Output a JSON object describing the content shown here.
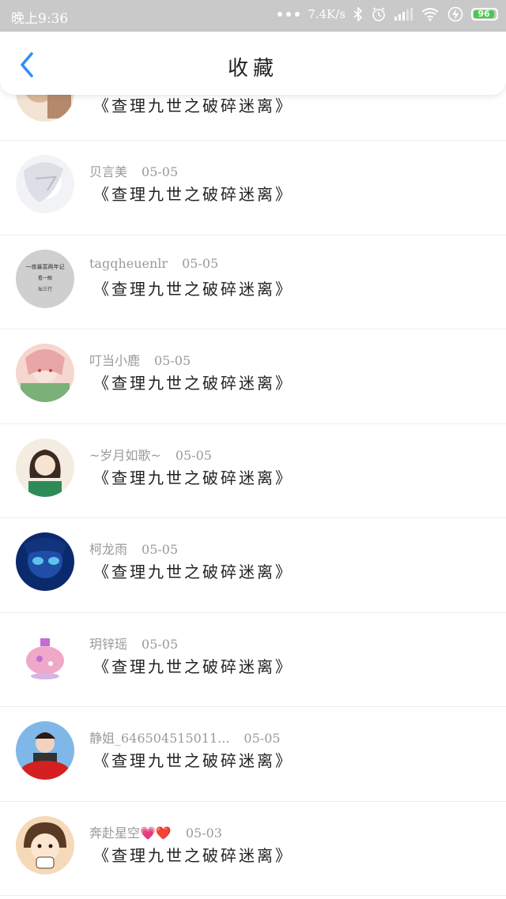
{
  "status_bar": {
    "time": "晚上9:36",
    "network_speed": "7.4K/s",
    "battery": "96",
    "colors": {
      "battery_fill": "#49c84b"
    }
  },
  "header": {
    "title": "收藏",
    "back_icon": "chevron-left-icon",
    "accent": "#2f8ff0"
  },
  "favorites": [
    {
      "user": "",
      "date": "",
      "post": "《查理九世之破碎迷离》",
      "avatar_colors": [
        "#d9b89a",
        "#f3e3d3",
        "#b48a6a"
      ]
    },
    {
      "user": "贝言美",
      "date": "05-05",
      "post": "《查理九世之破碎迷离》",
      "avatar_colors": [
        "#e7e9ee",
        "#ffffff",
        "#b9bcc6"
      ]
    },
    {
      "user": "tagqheuenlr",
      "date": "05-05",
      "post": "《查理九世之破碎迷离》",
      "avatar_text": [
        "一夜暴富两年记",
        "看一眼",
        "坛三行"
      ],
      "avatar_colors": [
        "#cfcfcf",
        "#cfcfcf",
        "#333333"
      ]
    },
    {
      "user": "叮当小鹿",
      "date": "05-05",
      "post": "《查理九世之破碎迷离》",
      "avatar_colors": [
        "#e9a6a6",
        "#f5d7d0",
        "#7bb079"
      ]
    },
    {
      "user": "~岁月如歌~",
      "date": "05-05",
      "post": "《查理九世之破碎迷离》",
      "avatar_colors": [
        "#f4ece0",
        "#3b2a22",
        "#2e8b57"
      ]
    },
    {
      "user": "柯龙雨",
      "date": "05-05",
      "post": "《查理九世之破碎迷离》",
      "avatar_colors": [
        "#1f4da8",
        "#5ec3ec",
        "#0b2a6e"
      ]
    },
    {
      "user": "玥锌瑶",
      "date": "05-05",
      "post": "《查理九世之破碎迷离》",
      "avatar_colors": [
        "#ffffff",
        "#f0a8c8",
        "#c46ad9"
      ]
    },
    {
      "user": "静姐_646504515011...",
      "date": "05-05",
      "post": "《查理九世之破碎迷离》",
      "avatar_colors": [
        "#7fb8e8",
        "#d42020",
        "#f1d2c0"
      ]
    },
    {
      "user": "奔赴星空💗❤️",
      "date": "05-03",
      "post": "《查理九世之破碎迷离》",
      "avatar_colors": [
        "#f5d9b8",
        "#ffffff",
        "#5a3a22"
      ]
    }
  ]
}
